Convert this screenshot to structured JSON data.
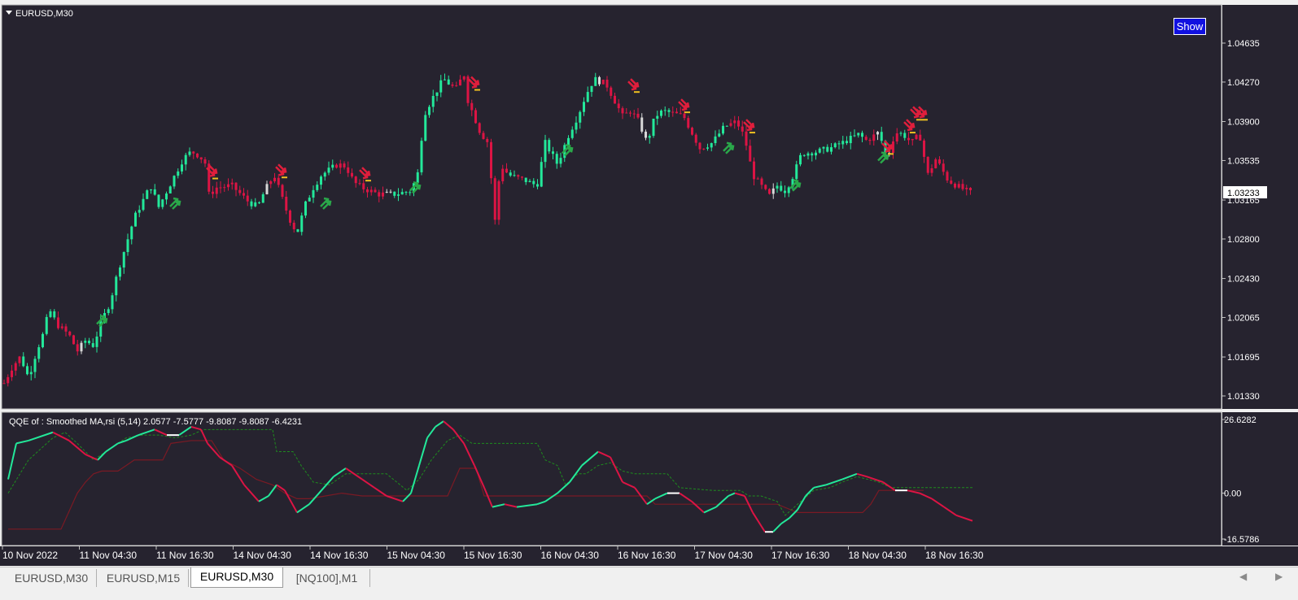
{
  "main_chart": {
    "symbol_label": "EURUSD,M30",
    "show_button": "Show",
    "current_price": "1.03233",
    "price_ticks": [
      "1.04635",
      "1.04270",
      "1.03900",
      "1.03535",
      "1.03165",
      "1.02800",
      "1.02430",
      "1.02065",
      "1.01695",
      "1.01330"
    ]
  },
  "indicator": {
    "label": "QQE of :  Smoothed MA,rsi (5,14) 2.0577 -7.5777 -9.8087 -9.8087 -6.4231",
    "ticks": [
      "26.6282",
      "0.00",
      "-16.5786"
    ]
  },
  "time_axis": [
    "10 Nov 2022",
    "11 Nov 04:30",
    "11 Nov 16:30",
    "14 Nov 04:30",
    "14 Nov 16:30",
    "15 Nov 04:30",
    "15 Nov 16:30",
    "16 Nov 04:30",
    "16 Nov 16:30",
    "17 Nov 04:30",
    "17 Nov 16:30",
    "18 Nov 04:30",
    "18 Nov 16:30"
  ],
  "tabs": [
    {
      "label": "EURUSD,M30",
      "active": false
    },
    {
      "label": "EURUSD,M15",
      "active": false
    },
    {
      "label": "EURUSD,M30",
      "active": true
    },
    {
      "label": "[NQ100],M1",
      "active": false
    }
  ],
  "colors": {
    "background": "#26232f",
    "bull": "#23e89a",
    "bear": "#dc1444",
    "neutral": "#d8d8d8",
    "buy_arrow": "#2aa84a",
    "sell_arrow": "#e01e3c",
    "signal_line": "#1e8c1e",
    "slow_line": "#7a1a24"
  },
  "chart_data": {
    "type": "candlestick",
    "symbol": "EURUSD",
    "timeframe": "M30",
    "price_range": [
      1.0115,
      1.0482
    ],
    "close_path": [
      [
        0,
        1.0145
      ],
      [
        10,
        1.016
      ],
      [
        20,
        1.017
      ],
      [
        30,
        1.015
      ],
      [
        40,
        1.0175
      ],
      [
        50,
        1.0195
      ],
      [
        55,
        1.0215
      ],
      [
        65,
        1.02
      ],
      [
        80,
        1.019
      ],
      [
        90,
        1.0175
      ],
      [
        100,
        1.0185
      ],
      [
        110,
        1.018
      ],
      [
        118,
        1.02
      ],
      [
        130,
        1.022
      ],
      [
        140,
        1.025
      ],
      [
        150,
        1.0275
      ],
      [
        160,
        1.03
      ],
      [
        170,
        1.0315
      ],
      [
        180,
        1.033
      ],
      [
        190,
        1.031
      ],
      [
        200,
        1.0325
      ],
      [
        210,
        1.034
      ],
      [
        220,
        1.0355
      ],
      [
        230,
        1.0362
      ],
      [
        240,
        1.0358
      ],
      [
        248,
        1.035
      ],
      [
        252,
        1.032
      ],
      [
        260,
        1.0328
      ],
      [
        280,
        1.033
      ],
      [
        300,
        1.0315
      ],
      [
        312,
        1.031
      ],
      [
        320,
        1.0325
      ],
      [
        332,
        1.034
      ],
      [
        340,
        1.0322
      ],
      [
        350,
        1.03
      ],
      [
        360,
        1.0285
      ],
      [
        370,
        1.0312
      ],
      [
        380,
        1.0328
      ],
      [
        390,
        1.034
      ],
      [
        400,
        1.0345
      ],
      [
        410,
        1.035
      ],
      [
        420,
        1.0348
      ],
      [
        430,
        1.0333
      ],
      [
        440,
        1.0328
      ],
      [
        460,
        1.0322
      ],
      [
        480,
        1.0322
      ],
      [
        500,
        1.0325
      ],
      [
        510,
        1.0345
      ],
      [
        515,
        1.0395
      ],
      [
        525,
        1.041
      ],
      [
        540,
        1.043
      ],
      [
        555,
        1.042
      ],
      [
        565,
        1.0435
      ],
      [
        570,
        1.041
      ],
      [
        575,
        1.04
      ],
      [
        585,
        1.038
      ],
      [
        595,
        1.037
      ],
      [
        603,
        1.0295
      ],
      [
        610,
        1.035
      ],
      [
        620,
        1.034
      ],
      [
        640,
        1.0335
      ],
      [
        655,
        1.033
      ],
      [
        665,
        1.037
      ],
      [
        680,
        1.035
      ],
      [
        695,
        1.038
      ],
      [
        705,
        1.0395
      ],
      [
        715,
        1.0415
      ],
      [
        725,
        1.043
      ],
      [
        740,
        1.0425
      ],
      [
        750,
        1.041
      ],
      [
        760,
        1.0395
      ],
      [
        770,
        1.04
      ],
      [
        780,
        1.039
      ],
      [
        790,
        1.037
      ],
      [
        800,
        1.0395
      ],
      [
        810,
        1.04
      ],
      [
        835,
        1.0395
      ],
      [
        845,
        1.038
      ],
      [
        855,
        1.0365
      ],
      [
        870,
        1.037
      ],
      [
        885,
        1.0385
      ],
      [
        900,
        1.039
      ],
      [
        910,
        1.0375
      ],
      [
        920,
        1.034
      ],
      [
        930,
        1.033
      ],
      [
        940,
        1.032
      ],
      [
        950,
        1.033
      ],
      [
        960,
        1.0325
      ],
      [
        970,
        1.034
      ],
      [
        980,
        1.036
      ],
      [
        1000,
        1.0362
      ],
      [
        1015,
        1.0365
      ],
      [
        1030,
        1.037
      ],
      [
        1050,
        1.0378
      ],
      [
        1060,
        1.0372
      ],
      [
        1075,
        1.038
      ],
      [
        1085,
        1.0355
      ],
      [
        1095,
        1.038
      ],
      [
        1105,
        1.0378
      ],
      [
        1115,
        1.037
      ],
      [
        1125,
        1.0378
      ],
      [
        1135,
        1.034
      ],
      [
        1145,
        1.0355
      ],
      [
        1160,
        1.0335
      ],
      [
        1175,
        1.0328
      ],
      [
        1188,
        1.0323
      ]
    ],
    "buy_signals": [
      [
        120,
        1.0205
      ],
      [
        210,
        1.0315
      ],
      [
        395,
        1.0315
      ],
      [
        505,
        1.033
      ],
      [
        692,
        1.0365
      ],
      [
        890,
        1.0367
      ],
      [
        972,
        1.0332
      ],
      [
        1080,
        1.0358
      ]
    ],
    "sell_signals": [
      [
        255,
        1.0342
      ],
      [
        340,
        1.0343
      ],
      [
        443,
        1.034
      ],
      [
        577,
        1.0425
      ],
      [
        773,
        1.0423
      ],
      [
        835,
        1.0404
      ],
      [
        915,
        1.0385
      ],
      [
        1085,
        1.0365
      ],
      [
        1112,
        1.0385
      ],
      [
        1120,
        1.0397
      ],
      [
        1127,
        1.0397
      ]
    ]
  },
  "indicator_data": {
    "range": [
      -16.5786,
      26.6282
    ],
    "qqe_path": [
      [
        5,
        5
      ],
      [
        15,
        18
      ],
      [
        30,
        19
      ],
      [
        60,
        22
      ],
      [
        80,
        19
      ],
      [
        100,
        14
      ],
      [
        115,
        12
      ],
      [
        125,
        15
      ],
      [
        140,
        18
      ],
      [
        150,
        19
      ],
      [
        165,
        21
      ],
      [
        185,
        23
      ],
      [
        200,
        21
      ],
      [
        215,
        21
      ],
      [
        230,
        24
      ],
      [
        242,
        23
      ],
      [
        250,
        18
      ],
      [
        265,
        13
      ],
      [
        280,
        10
      ],
      [
        295,
        3
      ],
      [
        313,
        -3
      ],
      [
        325,
        -1
      ],
      [
        335,
        3
      ],
      [
        345,
        1
      ],
      [
        360,
        -7
      ],
      [
        375,
        -4
      ],
      [
        390,
        1
      ],
      [
        405,
        6
      ],
      [
        420,
        9
      ],
      [
        440,
        5
      ],
      [
        455,
        2
      ],
      [
        470,
        -1
      ],
      [
        490,
        -3
      ],
      [
        500,
        0
      ],
      [
        510,
        10
      ],
      [
        520,
        20
      ],
      [
        530,
        24
      ],
      [
        540,
        26
      ],
      [
        552,
        23
      ],
      [
        565,
        18
      ],
      [
        578,
        10
      ],
      [
        590,
        2
      ],
      [
        600,
        -5
      ],
      [
        615,
        -4
      ],
      [
        630,
        -5
      ],
      [
        655,
        -4
      ],
      [
        665,
        -3
      ],
      [
        680,
        0
      ],
      [
        695,
        4
      ],
      [
        710,
        10
      ],
      [
        730,
        15
      ],
      [
        745,
        13
      ],
      [
        760,
        4
      ],
      [
        775,
        2
      ],
      [
        790,
        -4
      ],
      [
        800,
        -2
      ],
      [
        815,
        0
      ],
      [
        830,
        0
      ],
      [
        845,
        -3
      ],
      [
        860,
        -7
      ],
      [
        875,
        -5
      ],
      [
        890,
        -1
      ],
      [
        898,
        0
      ],
      [
        910,
        -1
      ],
      [
        920,
        -7
      ],
      [
        935,
        -14
      ],
      [
        945,
        -14
      ],
      [
        955,
        -11
      ],
      [
        965,
        -9
      ],
      [
        975,
        -6
      ],
      [
        985,
        -1
      ],
      [
        995,
        2
      ],
      [
        1010,
        3
      ],
      [
        1030,
        5
      ],
      [
        1048,
        7
      ],
      [
        1060,
        6
      ],
      [
        1080,
        4
      ],
      [
        1095,
        1
      ],
      [
        1110,
        1
      ],
      [
        1125,
        0
      ],
      [
        1140,
        -2
      ],
      [
        1155,
        -5
      ],
      [
        1170,
        -8
      ],
      [
        1190,
        -10
      ]
    ],
    "signal_path": [
      [
        5,
        0
      ],
      [
        30,
        12
      ],
      [
        60,
        20
      ],
      [
        75,
        22
      ],
      [
        90,
        18
      ],
      [
        110,
        12
      ],
      [
        130,
        16
      ],
      [
        150,
        20
      ],
      [
        170,
        21
      ],
      [
        190,
        21
      ],
      [
        210,
        20
      ],
      [
        230,
        21
      ],
      [
        245,
        23
      ],
      [
        260,
        23
      ],
      [
        280,
        23
      ],
      [
        300,
        23
      ],
      [
        320,
        23
      ],
      [
        330,
        23
      ],
      [
        335,
        15
      ],
      [
        355,
        15
      ],
      [
        365,
        10
      ],
      [
        380,
        4
      ],
      [
        400,
        3
      ],
      [
        420,
        7
      ],
      [
        440,
        7
      ],
      [
        455,
        7
      ],
      [
        470,
        7
      ],
      [
        495,
        1
      ],
      [
        510,
        5
      ],
      [
        525,
        12
      ],
      [
        545,
        19
      ],
      [
        560,
        21
      ],
      [
        575,
        18
      ],
      [
        580,
        18
      ],
      [
        655,
        18
      ],
      [
        665,
        12
      ],
      [
        680,
        10
      ],
      [
        690,
        3
      ],
      [
        705,
        7
      ],
      [
        715,
        7
      ],
      [
        730,
        10
      ],
      [
        745,
        11
      ],
      [
        760,
        8
      ],
      [
        775,
        7
      ],
      [
        790,
        7
      ],
      [
        800,
        7
      ],
      [
        815,
        7
      ],
      [
        830,
        2
      ],
      [
        870,
        1
      ],
      [
        895,
        1
      ],
      [
        905,
        1
      ],
      [
        915,
        -1
      ],
      [
        930,
        -1
      ],
      [
        950,
        -3
      ],
      [
        960,
        -8
      ],
      [
        975,
        -4
      ],
      [
        995,
        1
      ],
      [
        1015,
        2
      ],
      [
        1030,
        4
      ],
      [
        1048,
        6
      ],
      [
        1075,
        4
      ],
      [
        1090,
        2
      ],
      [
        1120,
        2
      ],
      [
        1190,
        2
      ]
    ],
    "slow_path": [
      [
        5,
        -13
      ],
      [
        70,
        -13
      ],
      [
        90,
        0
      ],
      [
        100,
        4
      ],
      [
        110,
        7
      ],
      [
        120,
        8
      ],
      [
        140,
        8
      ],
      [
        150,
        10
      ],
      [
        160,
        12
      ],
      [
        175,
        12
      ],
      [
        195,
        12
      ],
      [
        205,
        18
      ],
      [
        230,
        19
      ],
      [
        245,
        19
      ],
      [
        255,
        19
      ],
      [
        270,
        12
      ],
      [
        290,
        9
      ],
      [
        310,
        5
      ],
      [
        330,
        3
      ],
      [
        345,
        0
      ],
      [
        360,
        -2
      ],
      [
        375,
        -2
      ],
      [
        395,
        -1
      ],
      [
        415,
        0
      ],
      [
        440,
        -1
      ],
      [
        480,
        -1
      ],
      [
        545,
        -1
      ],
      [
        560,
        9
      ],
      [
        570,
        9
      ],
      [
        580,
        9
      ],
      [
        590,
        -1
      ],
      [
        640,
        -1
      ],
      [
        680,
        -1
      ],
      [
        700,
        -1
      ],
      [
        720,
        -1
      ],
      [
        745,
        -1
      ],
      [
        760,
        -1
      ],
      [
        775,
        -1
      ],
      [
        790,
        -1
      ],
      [
        800,
        -4
      ],
      [
        830,
        -4
      ],
      [
        860,
        -4
      ],
      [
        900,
        -4
      ],
      [
        915,
        -4
      ],
      [
        935,
        -4
      ],
      [
        950,
        -4
      ],
      [
        975,
        -7
      ],
      [
        1010,
        -7
      ],
      [
        1040,
        -7
      ],
      [
        1055,
        -7
      ],
      [
        1065,
        -4
      ],
      [
        1075,
        1
      ],
      [
        1085,
        1
      ],
      [
        1110,
        1
      ],
      [
        1130,
        1
      ]
    ]
  }
}
